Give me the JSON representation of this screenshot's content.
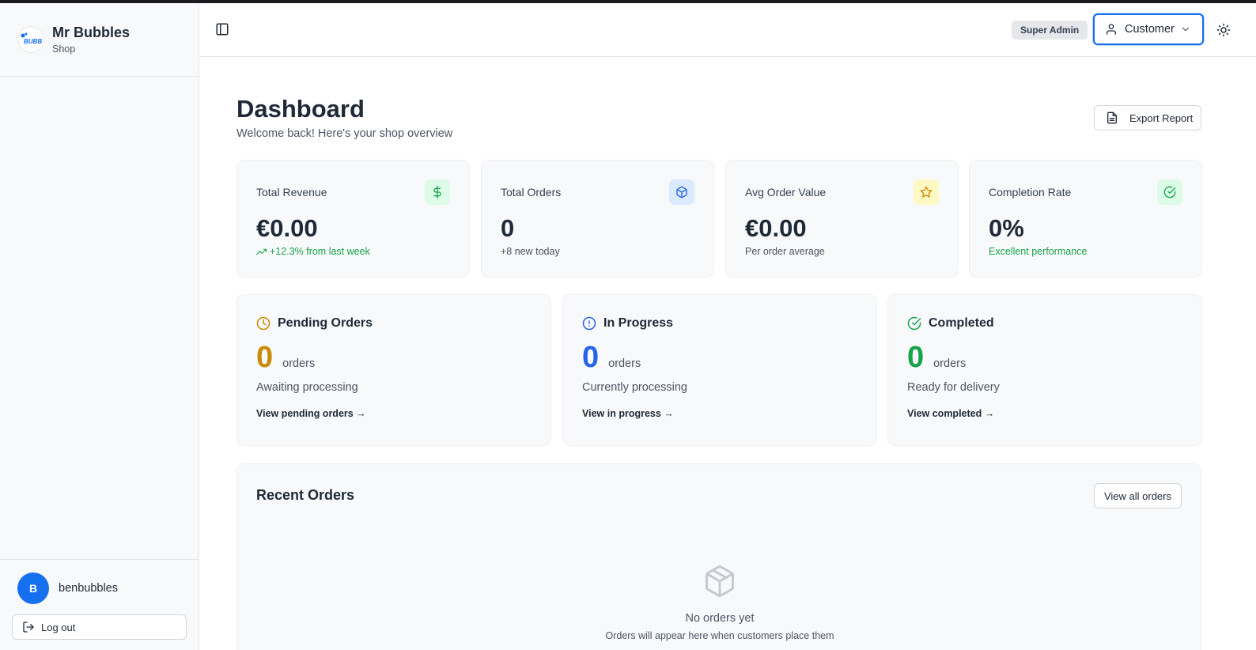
{
  "brand": {
    "name": "Mr Bubbles",
    "subtitle": "Shop",
    "logo_text": "BUBB"
  },
  "user": {
    "initial": "B",
    "username": "benbubbles",
    "logout_label": "Log out"
  },
  "header": {
    "role_badge": "Super Admin",
    "role_select": "Customer"
  },
  "page": {
    "title": "Dashboard",
    "subtitle": "Welcome back! Here's your shop overview",
    "export_label": "Export Report"
  },
  "stats": [
    {
      "label": "Total Revenue",
      "value": "€0.00",
      "note": "+12.3% from last week",
      "icon": "dollar-icon",
      "color": "#16a34a",
      "bg": "#dcfce7"
    },
    {
      "label": "Total Orders",
      "value": "0",
      "note": "+8 new today",
      "icon": "package-icon",
      "color": "#2563eb",
      "bg": "#dbeafe"
    },
    {
      "label": "Avg Order Value",
      "value": "€0.00",
      "note": "Per order average",
      "icon": "star-icon",
      "color": "#ca8a04",
      "bg": "#fef9c3"
    },
    {
      "label": "Completion Rate",
      "value": "0%",
      "note": "Excellent performance",
      "icon": "check-circle-icon",
      "color": "#16a34a",
      "bg": "#dcfce7"
    }
  ],
  "status": [
    {
      "title": "Pending Orders",
      "count": "0",
      "unit": "orders",
      "desc": "Awaiting processing",
      "link": "View pending orders →",
      "color": "#ca8a04",
      "icon": "clock-icon"
    },
    {
      "title": "In Progress",
      "count": "0",
      "unit": "orders",
      "desc": "Currently processing",
      "link": "View in progress →",
      "color": "#2563eb",
      "icon": "alert-circle-icon"
    },
    {
      "title": "Completed",
      "count": "0",
      "unit": "orders",
      "desc": "Ready for delivery",
      "link": "View completed →",
      "color": "#16a34a",
      "icon": "check-circle-icon"
    }
  ],
  "recent": {
    "title": "Recent Orders",
    "view_all": "View all orders",
    "empty_title": "No orders yet",
    "empty_sub": "Orders will appear here when customers place them"
  }
}
